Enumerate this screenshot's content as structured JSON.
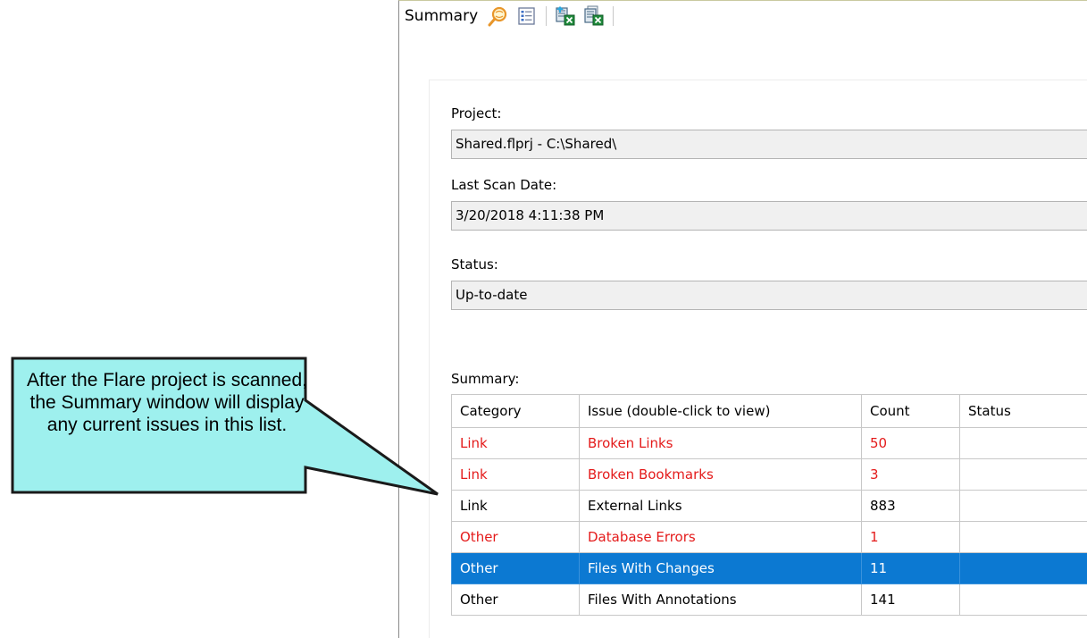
{
  "toolbar": {
    "title": "Summary",
    "buttons": [
      {
        "icon": "search-globe-icon"
      },
      {
        "icon": "list-view-icon"
      },
      {
        "icon": "export-excel-icon"
      },
      {
        "icon": "export-all-excel-icon"
      }
    ]
  },
  "fields": {
    "project_label": "Project:",
    "project_value": "Shared.flprj - C:\\Shared\\",
    "scan_date_label": "Last Scan Date:",
    "scan_date_value": "3/20/2018 4:11:38 PM",
    "status_label": "Status:",
    "status_value": "Up-to-date"
  },
  "summary": {
    "label": "Summary:",
    "columns": [
      "Category",
      "Issue (double-click to view)",
      "Count",
      "Status"
    ],
    "rows": [
      {
        "category": "Link",
        "issue": "Broken Links",
        "count": "50",
        "status": "",
        "error": true,
        "selected": false
      },
      {
        "category": "Link",
        "issue": "Broken Bookmarks",
        "count": "3",
        "status": "",
        "error": true,
        "selected": false
      },
      {
        "category": "Link",
        "issue": "External Links",
        "count": "883",
        "status": "",
        "error": false,
        "selected": false
      },
      {
        "category": "Other",
        "issue": "Database Errors",
        "count": "1",
        "status": "",
        "error": true,
        "selected": false
      },
      {
        "category": "Other",
        "issue": "Files With Changes",
        "count": "11",
        "status": "",
        "error": false,
        "selected": true
      },
      {
        "category": "Other",
        "issue": "Files With Annotations",
        "count": "141",
        "status": "",
        "error": false,
        "selected": false
      }
    ]
  },
  "callout": {
    "text": "After the Flare project is scanned, the Summary window will display any current issues in this list."
  },
  "colors": {
    "error_text": "#e41b1b",
    "selection": "#0c79d2",
    "callout_fill": "#9ef0ee"
  }
}
